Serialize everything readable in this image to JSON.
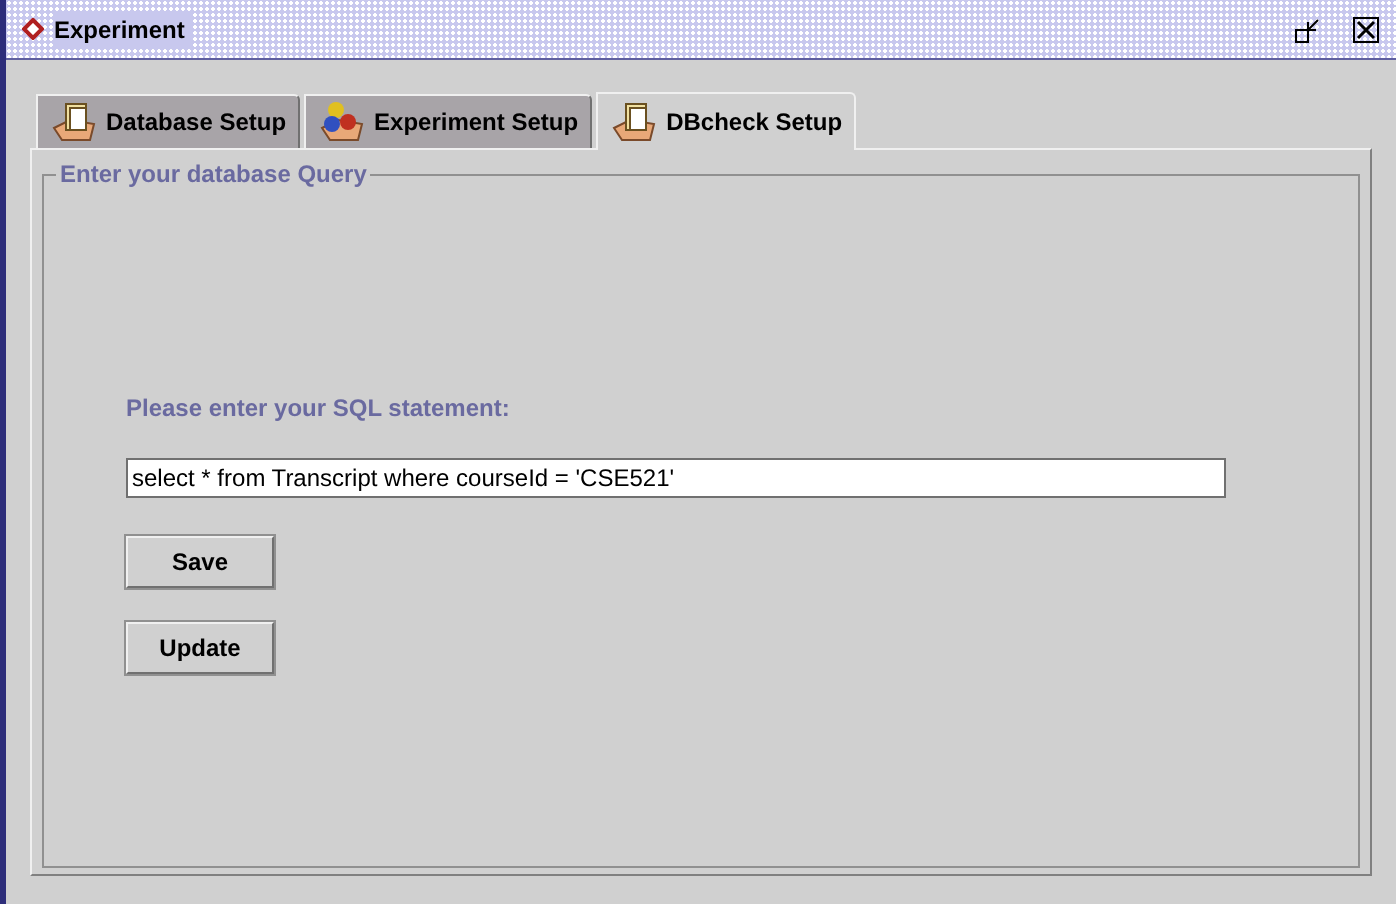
{
  "window": {
    "title": "Experiment"
  },
  "tabs": [
    {
      "label": "Database Setup",
      "selected": false,
      "kind": "folder"
    },
    {
      "label": "Experiment Setup",
      "selected": false,
      "kind": "molecule"
    },
    {
      "label": "DBcheck Setup",
      "selected": true,
      "kind": "folder"
    }
  ],
  "group": {
    "title": "Enter your database Query"
  },
  "prompt": "Please enter your SQL statement:",
  "query_field": {
    "value": "select * from Transcript where courseId = 'CSE521'"
  },
  "buttons": [
    "Save",
    "Update"
  ]
}
